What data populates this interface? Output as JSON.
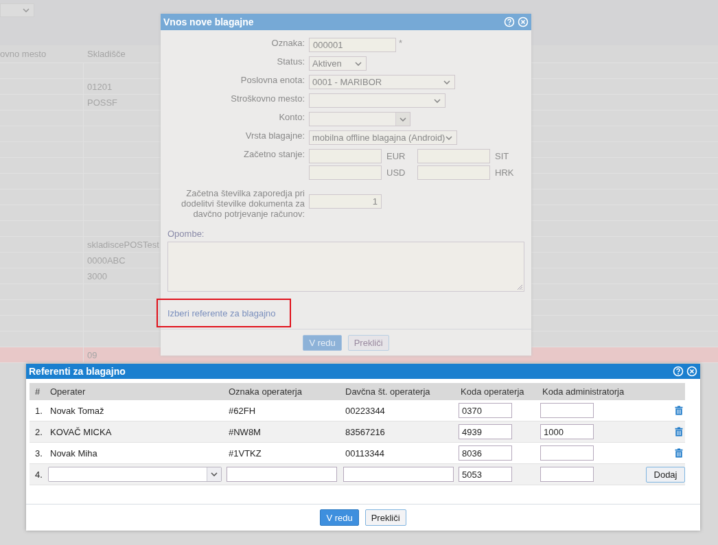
{
  "background_table": {
    "columns": [
      "ovno mesto",
      "Skladišče"
    ],
    "rows": [
      {
        "selected": false
      },
      {
        "selected": false,
        "warehouse": "01201"
      },
      {
        "selected": false,
        "warehouse": "POSSF"
      },
      {
        "selected": false
      },
      {
        "selected": false
      },
      {
        "selected": false
      },
      {
        "selected": false
      },
      {
        "selected": false
      },
      {
        "selected": false
      },
      {
        "selected": false
      },
      {
        "selected": false
      },
      {
        "selected": false,
        "warehouse": "skladiscePOSTest"
      },
      {
        "selected": false,
        "warehouse": "0000ABC"
      },
      {
        "selected": false,
        "warehouse": "3000"
      },
      {
        "selected": false
      },
      {
        "selected": false
      },
      {
        "selected": false
      },
      {
        "selected": false
      },
      {
        "selected": true,
        "warehouse": "09"
      }
    ]
  },
  "cash_register_dialog": {
    "title": "Vnos nove blagajne",
    "fields": [
      {
        "kind": "text",
        "label": "Oznaka:",
        "value": "000001",
        "required_mark": "*"
      },
      {
        "kind": "select",
        "label": "Status:",
        "value": "Aktiven"
      },
      {
        "kind": "select",
        "label": "Poslovna enota:",
        "value": "0001 - MARIBOR"
      },
      {
        "kind": "select",
        "label": "Stroškovno mesto:"
      },
      {
        "kind": "combo",
        "label": "Konto:"
      },
      {
        "kind": "select",
        "label": "Vrsta blagajne:",
        "value": "mobilna offline blagajna (Android)"
      },
      {
        "kind": "currency",
        "label": "Začetno stanje:",
        "currencies": [
          "EUR",
          "SIT",
          "USD",
          "HRK"
        ]
      },
      {
        "kind": "number",
        "label": "Začetna številka zaporedja pri dodelitvi številke dokumenta za davčno potrjevanje računov:",
        "value": "1"
      }
    ],
    "notes_label": "Opombe:",
    "link": {
      "text": "Izberi referente za blagajno",
      "highlighted": true
    },
    "buttons": [
      {
        "label": "V redu",
        "kind": "primary"
      },
      {
        "label": "Prekliči",
        "kind": "secondary"
      }
    ]
  },
  "operators_dialog": {
    "title": "Referenti za blagajno",
    "columns": [
      "#",
      "Operater",
      "Oznaka operaterja",
      "Davčna št. operaterja",
      "Koda operaterja",
      "Koda administratorja"
    ],
    "rows": [
      {
        "kind": "existing",
        "number": "1.",
        "operator": "Novak Tomaž",
        "tag": "#62FH",
        "tax_number": "00223344",
        "operator_code": "0370"
      },
      {
        "kind": "existing",
        "number": "2.",
        "operator": "KOVAČ MICKA",
        "tag": "#NW8M",
        "tax_number": "83567216",
        "operator_code": "4939",
        "admin_code": "1000"
      },
      {
        "kind": "existing",
        "number": "3.",
        "operator": "Novak Miha",
        "tag": "#1VTKZ",
        "tax_number": "00113344",
        "operator_code": "8036"
      },
      {
        "kind": "new",
        "number": "4.",
        "operator_code": "5053",
        "add_button": "Dodaj"
      }
    ],
    "buttons": [
      {
        "label": "V redu",
        "kind": "primary"
      },
      {
        "label": "Prekliči",
        "kind": "secondary"
      }
    ]
  }
}
